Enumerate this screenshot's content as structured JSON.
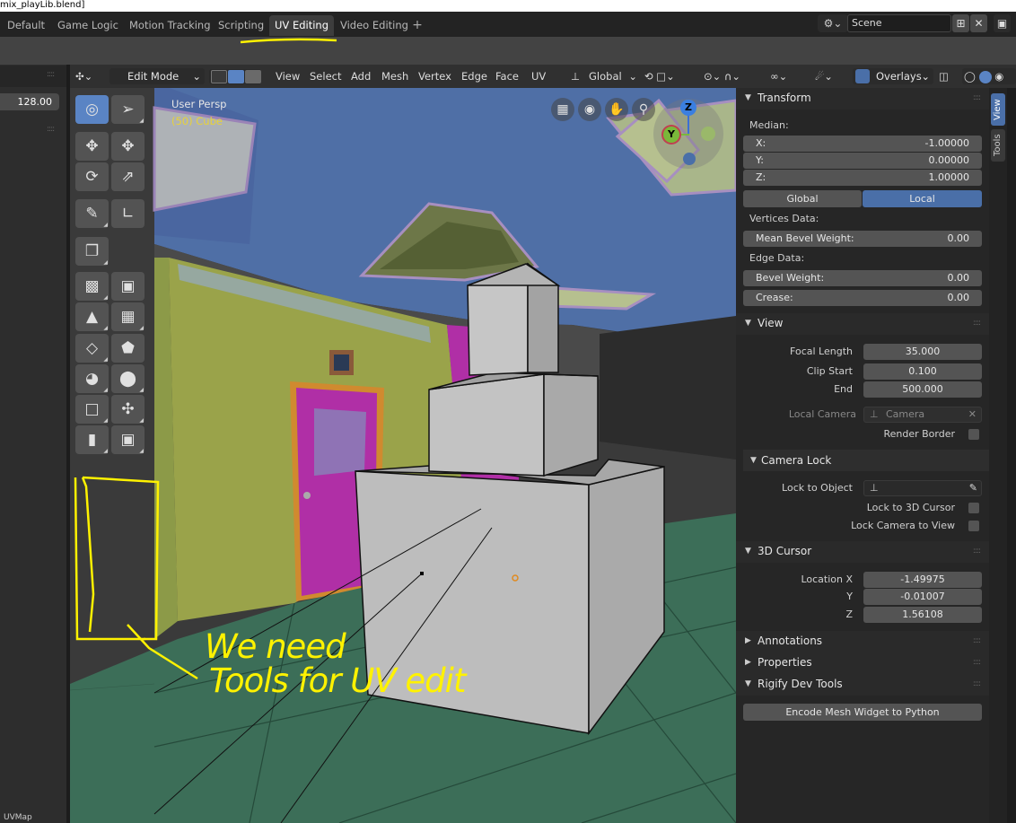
{
  "window": {
    "title": "mix_playLib.blend]"
  },
  "workspace_tabs": [
    "Default",
    "Game Logic",
    "Motion Tracking",
    "Scripting",
    "UV Editing",
    "Video Editing"
  ],
  "active_workspace": "UV Editing",
  "scene": {
    "label": "Scene"
  },
  "left_panel": {
    "value": "128.00",
    "uvmap_label": "UVMap"
  },
  "viewport_header": {
    "mode": "Edit Mode",
    "menus": [
      "View",
      "Select",
      "Add",
      "Mesh",
      "Vertex",
      "Edge",
      "Face",
      "UV"
    ],
    "orientation": "Global",
    "overlays": "Overlays"
  },
  "viewport": {
    "view_label": "User Persp",
    "object_label": "(50) Cube"
  },
  "gizmo": {
    "z": "Z",
    "y": "Y"
  },
  "side_tabs": {
    "view": "View",
    "tools": "Tools"
  },
  "transform": {
    "title": "Transform",
    "median_label": "Median:",
    "x_label": "X:",
    "x": "-1.00000",
    "y_label": "Y:",
    "y": "0.00000",
    "z_label": "Z:",
    "z": "1.00000",
    "space_global": "Global",
    "space_local": "Local",
    "vertices_data": "Vertices Data:",
    "mean_bevel_label": "Mean Bevel Weight:",
    "mean_bevel": "0.00",
    "edge_data": "Edge Data:",
    "bevel_label": "Bevel Weight:",
    "bevel": "0.00",
    "crease_label": "Crease:",
    "crease": "0.00"
  },
  "view_panel": {
    "title": "View",
    "focal_label": "Focal Length",
    "focal": "35.000",
    "clip_start_label": "Clip Start",
    "clip_start": "0.100",
    "end_label": "End",
    "end": "500.000",
    "local_camera_label": "Local Camera",
    "local_camera_placeholder": "Camera",
    "render_border_label": "Render Border",
    "camera_lock_title": "Camera Lock",
    "lock_object_label": "Lock to Object",
    "lock_cursor_label": "Lock to 3D Cursor",
    "lock_camera_label": "Lock Camera to View"
  },
  "cursor_panel": {
    "title": "3D Cursor",
    "loc_x_label": "Location X",
    "loc_x": "-1.49975",
    "loc_y_label": "Y",
    "loc_y": "-0.01007",
    "loc_z_label": "Z",
    "loc_z": "1.56108"
  },
  "collapsed_panels": {
    "annotations": "Annotations",
    "properties": "Properties"
  },
  "rigify": {
    "title": "Rigify Dev Tools",
    "button": "Encode Mesh Widget to Python"
  },
  "annotation": {
    "line1": "We need",
    "line2": "Tools for UV edit"
  },
  "colors": {
    "accent": "#5a84c4",
    "annotation": "#fff200",
    "ceiling": "#4f6fa6",
    "floor": "#3c6e58",
    "door": "#b02fa6"
  }
}
